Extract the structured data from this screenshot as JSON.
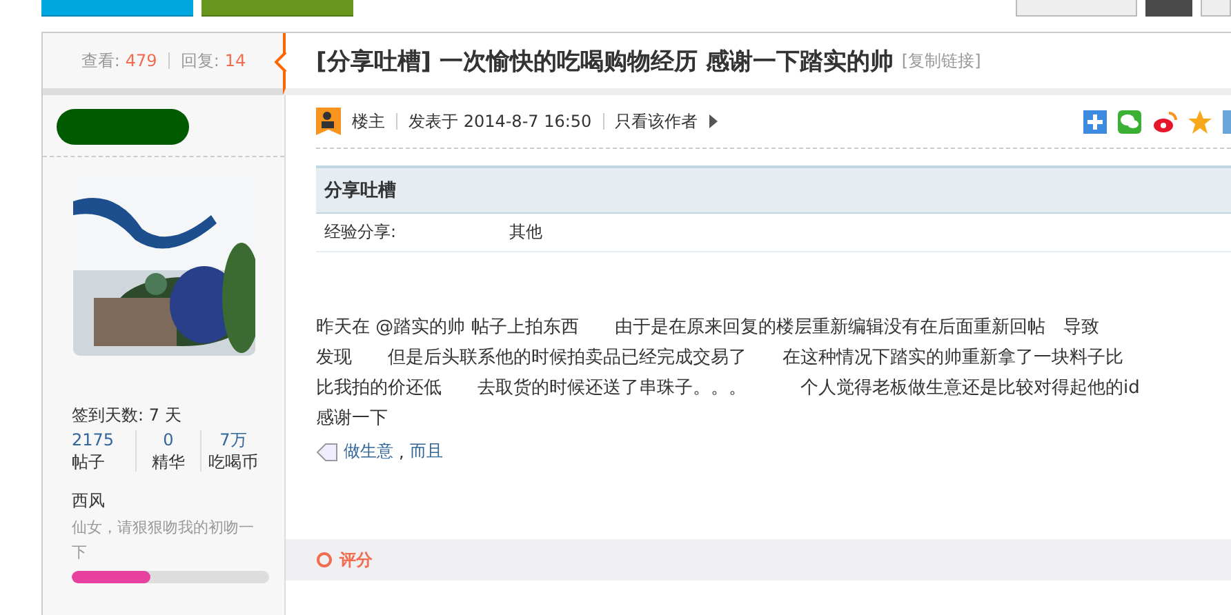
{
  "stats": {
    "views_label": "查看:",
    "views": "479",
    "replies_label": "回复:",
    "replies": "14"
  },
  "author": {
    "checkin": "签到天数: 7 天",
    "counts": [
      {
        "value": "2175",
        "label": "帖子"
      },
      {
        "value": "0",
        "label": "精华"
      },
      {
        "value": "7万",
        "label": "吃喝币"
      }
    ],
    "group": "西风",
    "signature": "仙女，请狠狠吻我的初吻一下",
    "level": 0.4
  },
  "post": {
    "title": "[分享吐槽] 一次愉快的吃喝购物经历 感谢一下踏实的帅",
    "copy_link": "[复制链接]",
    "role": "楼主",
    "posted": "发表于 2014-8-7 16:50",
    "only_author": "只看该作者",
    "category": {
      "heading": "分享吐槽",
      "field": "经验分享:",
      "value": "其他"
    },
    "lines": [
      "昨天在 @踏实的帅 帖子上拍东西　　由于是在原来回复的楼层重新编辑没有在后面重新回帖　导致",
      "发现　　但是后头联系他的时候拍卖品已经完成交易了　　在这种情况下踏实的帅重新拿了一块料子比",
      "比我拍的价还低　　去取货的时候还送了串珠子。。。　　　个人觉得老板做生意还是比较对得起他的id",
      "感谢一下"
    ],
    "tags": [
      "做生意",
      "而且"
    ],
    "tag_separator": ",",
    "rate": "评分"
  }
}
